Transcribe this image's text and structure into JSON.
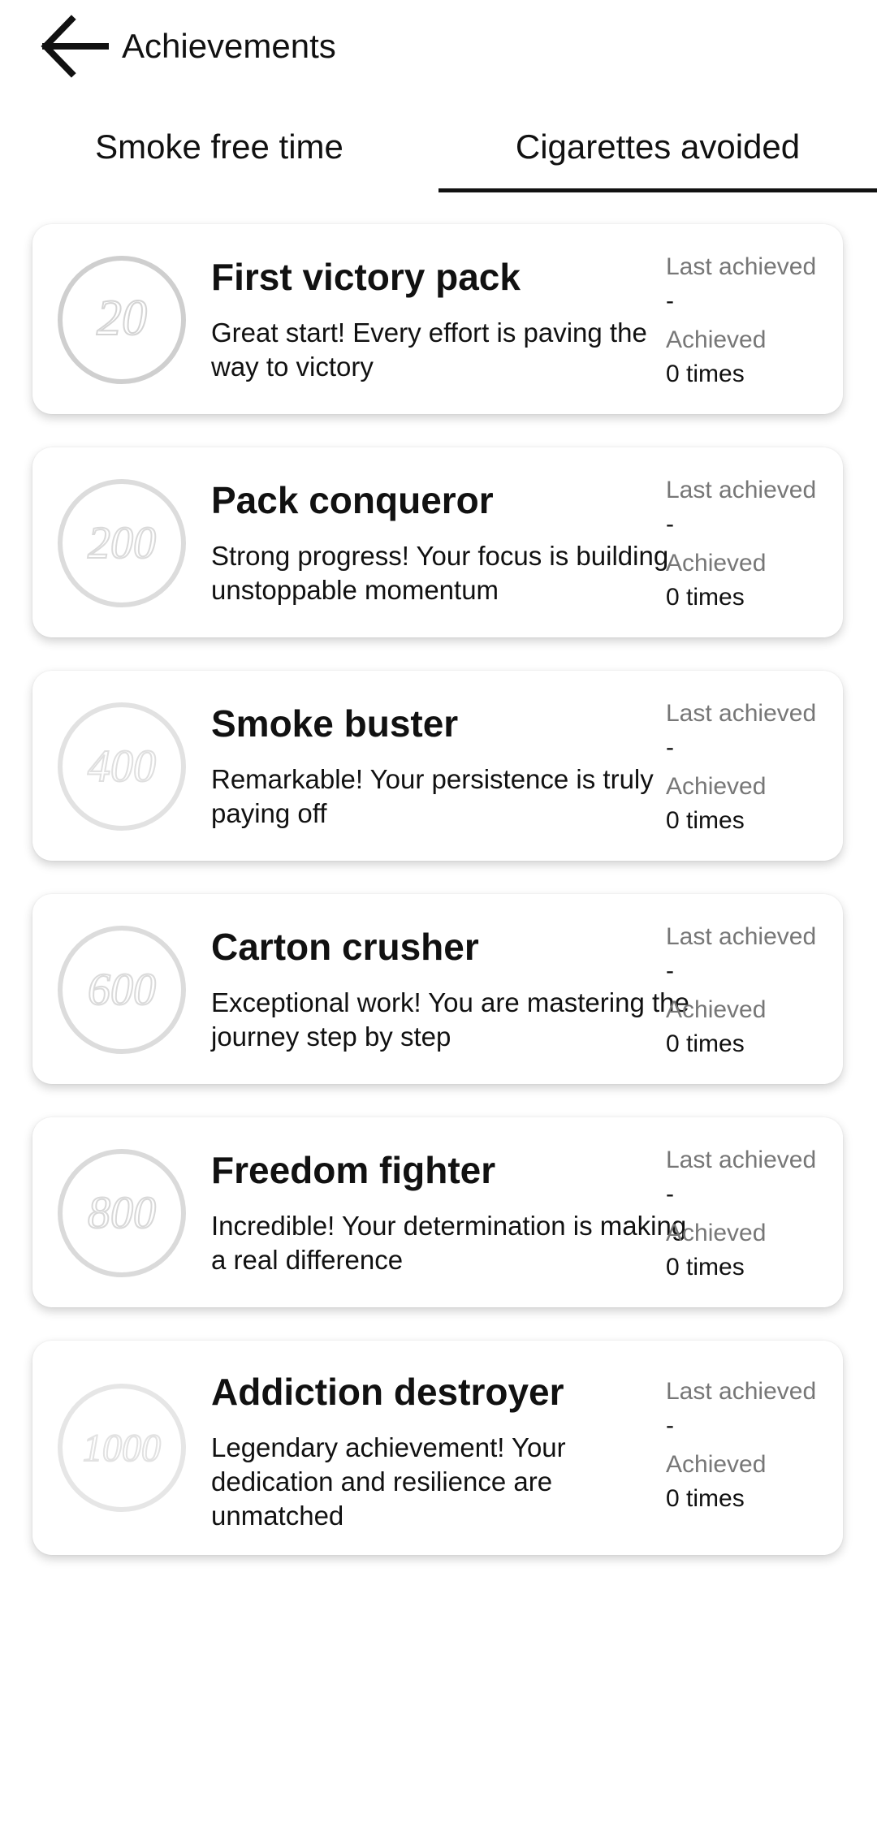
{
  "header": {
    "title": "Achievements",
    "back_icon": "arrow-left-icon"
  },
  "tabs": [
    {
      "label": "Smoke free time",
      "selected": false
    },
    {
      "label": "Cigarettes avoided",
      "selected": true
    }
  ],
  "achievements": [
    {
      "badge": "20",
      "title": "First victory pack",
      "description": "Great start! Every effort is paving the way to victory",
      "last_achieved_label": "Last achieved",
      "last_achieved_value": "-",
      "achieved_label": "Achieved",
      "achieved_value": "0 times"
    },
    {
      "badge": "200",
      "title": "Pack conqueror",
      "description": "Strong progress! Your focus is building unstoppable momentum",
      "last_achieved_label": "Last achieved",
      "last_achieved_value": "-",
      "achieved_label": "Achieved",
      "achieved_value": "0 times"
    },
    {
      "badge": "400",
      "title": "Smoke buster",
      "description": "Remarkable! Your persistence is truly paying off",
      "last_achieved_label": "Last achieved",
      "last_achieved_value": "-",
      "achieved_label": "Achieved",
      "achieved_value": "0 times"
    },
    {
      "badge": "600",
      "title": "Carton crusher",
      "description": "Exceptional work! You are mastering the journey step by step",
      "last_achieved_label": "Last achieved",
      "last_achieved_value": "-",
      "achieved_label": "Achieved",
      "achieved_value": "0 times"
    },
    {
      "badge": "800",
      "title": "Freedom fighter",
      "description": "Incredible! Your determination is making a real difference",
      "last_achieved_label": "Last achieved",
      "last_achieved_value": "-",
      "achieved_label": "Achieved",
      "achieved_value": "0 times"
    },
    {
      "badge": "1000",
      "title": "Addiction destroyer",
      "description": "Legendary achievement! Your dedication and resilience are unmatched",
      "last_achieved_label": "Last achieved",
      "last_achieved_value": "-",
      "achieved_label": "Achieved",
      "achieved_value": "0 times"
    }
  ],
  "colors": {
    "text": "#111111",
    "muted_text": "#777777",
    "tab_indicator": "#111111",
    "badge_ring": "#d9d9d9"
  }
}
